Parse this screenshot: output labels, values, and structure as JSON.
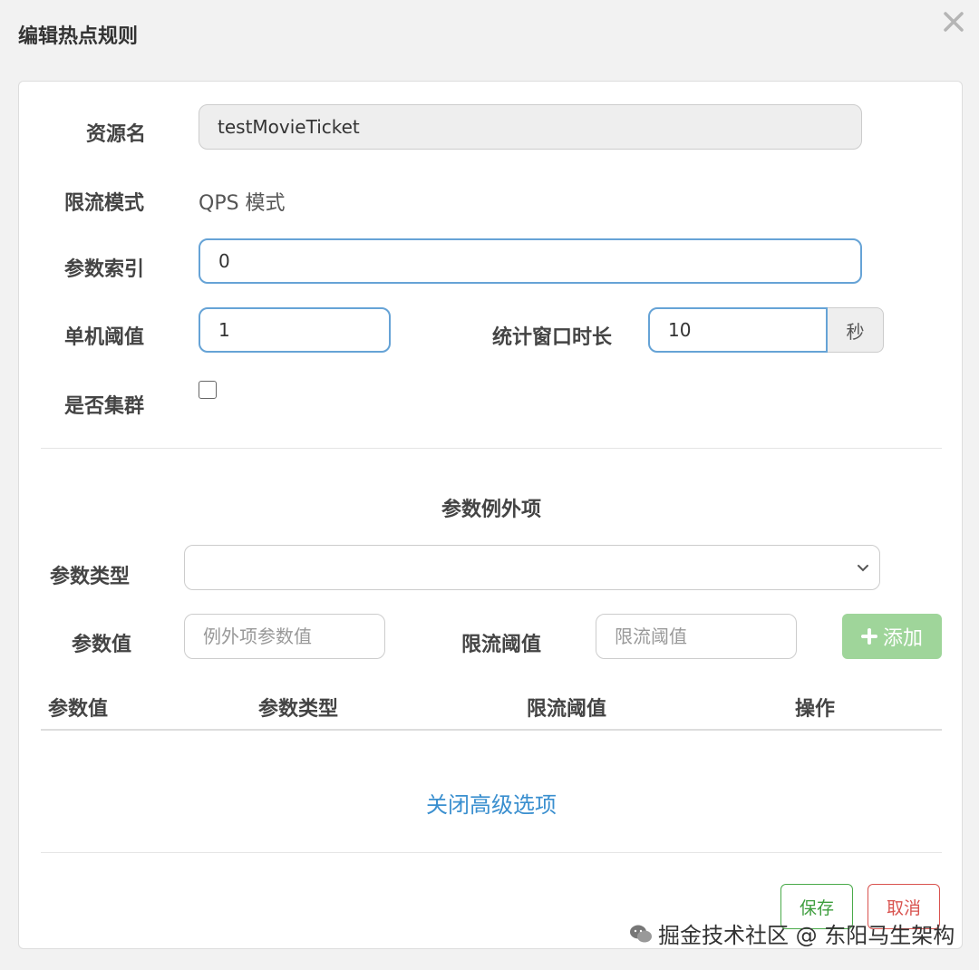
{
  "dialog": {
    "title": "编辑热点规则"
  },
  "form": {
    "resource_label": "资源名",
    "resource_value": "testMovieTicket",
    "mode_label": "限流模式",
    "mode_value": "QPS 模式",
    "param_index_label": "参数索引",
    "param_index_value": "0",
    "threshold_label": "单机阈值",
    "threshold_value": "1",
    "window_label": "统计窗口时长",
    "window_value": "10",
    "window_unit": "秒",
    "cluster_label": "是否集群",
    "cluster_checked": false
  },
  "exceptions": {
    "section_title": "参数例外项",
    "param_type_label": "参数类型",
    "param_type_value": "",
    "param_value_label": "参数值",
    "param_value_placeholder": "例外项参数值",
    "limit_label": "限流阈值",
    "limit_placeholder": "限流阈值",
    "add_label": "添加",
    "columns": [
      "参数值",
      "参数类型",
      "限流阈值",
      "操作"
    ],
    "rows": []
  },
  "advanced_toggle": "关闭高级选项",
  "footer": {
    "save_label": "保存",
    "cancel_label": "取消"
  },
  "watermark": {
    "text": "掘金技术社区 @ 东阳马生架构"
  },
  "colors": {
    "primary_link": "#3a8fcf",
    "save": "#3e9e3e",
    "cancel": "#d9534f",
    "add_button": "#9fd59a",
    "focused_border": "#66a3d6"
  }
}
